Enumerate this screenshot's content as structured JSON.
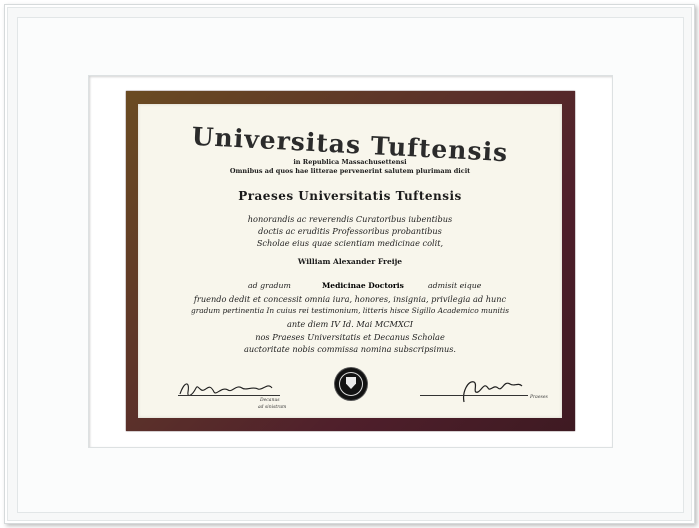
{
  "diploma": {
    "title": "Universitas Tuftensis",
    "subtitle": "in Republica Massachusettensi",
    "motto": "Omnibus ad quos hae litterae pervenerint salutem plurimam dicit",
    "praeses": "Praeses Universitatis Tuftensis",
    "lines": [
      "honorandis ac reverendis Curatoribus iubentibus",
      "doctis ac eruditis Professoribus probantibus",
      "Scholae eius quae scientiam medicinae colit,"
    ],
    "recipient": "William Alexander Freije",
    "ad_gradum": "ad gradum",
    "degree": "Medicinae Doctoris",
    "admisit": "admisit eique",
    "body_lines": [
      "fruendo dedit et concessit omnia iura, honores, insignia, privilegia ad hunc",
      "gradum pertinentia In cuius rei testimonium, litteris hisce Sigillo Academico munitis",
      "ante diem IV Id. Mai MCMXCI",
      "nos Praeses Universitatis et Decanus Scholae",
      "auctoritate nobis commissa nomina subscripsimus."
    ],
    "captions": {
      "left_1": "Decanus",
      "left_2": "ad sinistram",
      "right": "Praeses"
    }
  },
  "seal": {
    "icon": "university-seal"
  },
  "colors": {
    "frame": "#f7f8f8",
    "mat": "#ffffff",
    "border_band": "#5a2f2a",
    "paper": "#f8f6ec",
    "seal": "#121212"
  }
}
